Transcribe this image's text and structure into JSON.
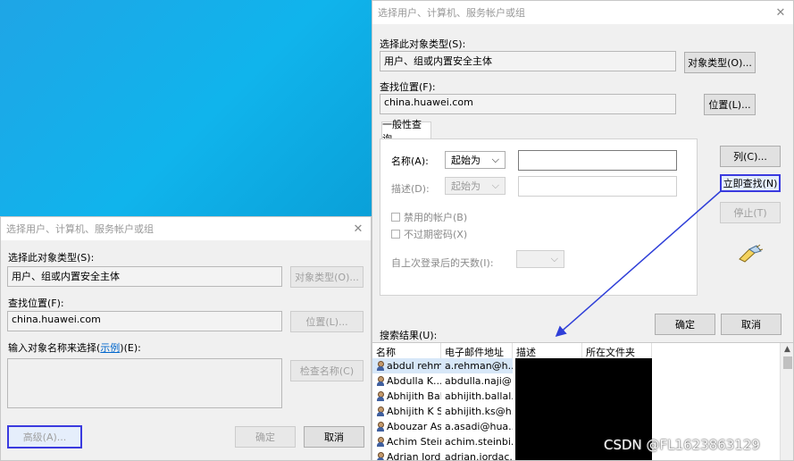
{
  "left_dialog": {
    "title": "选择用户、计算机、服务帐户或组",
    "object_type_label": "选择此对象类型(S):",
    "object_type_value": "用户、组或内置安全主体",
    "object_types_button": "对象类型(O)...",
    "location_label": "查找位置(F):",
    "location_value": "china.huawei.com",
    "location_button": "位置(L)...",
    "enter_names_label_prefix": "输入对象名称来选择(",
    "enter_names_link": "示例",
    "enter_names_label_suffix": ")(E):",
    "check_names_button": "检查名称(C)",
    "advanced_button": "高级(A)...",
    "ok_button": "确定",
    "cancel_button": "取消"
  },
  "right_dialog": {
    "title": "选择用户、计算机、服务帐户或组",
    "object_type_label": "选择此对象类型(S):",
    "object_type_value": "用户、组或内置安全主体",
    "object_types_button": "对象类型(O)...",
    "location_label": "查找位置(F):",
    "location_value": "china.huawei.com",
    "location_button": "位置(L)...",
    "tab_label": "一般性查询",
    "name_label": "名称(A):",
    "name_match": "起始为",
    "desc_label": "描述(D):",
    "desc_match": "起始为",
    "disabled_accounts": "禁用的帐户(B)",
    "non_expiring_pw": "不过期密码(X)",
    "days_since_logon": "自上次登录后的天数(I):",
    "columns_button": "列(C)...",
    "find_now_button": "立即查找(N)",
    "stop_button": "停止(T)",
    "ok_button": "确定",
    "cancel_button": "取消",
    "results_label": "搜索结果(U):",
    "columns": [
      "名称",
      "电子邮件地址",
      "描述",
      "所在文件夹"
    ],
    "rows": [
      {
        "name": "abdul rehm...",
        "email": "a.rehman@h..."
      },
      {
        "name": "Abdulla K...",
        "email": "abdulla.naji@..."
      },
      {
        "name": "Abhijith Bal...",
        "email": "abhijith.ballal..."
      },
      {
        "name": "Abhijith K S...",
        "email": "abhijith.ks@h..."
      },
      {
        "name": "Abouzar As...",
        "email": "a.asadi@hua..."
      },
      {
        "name": "Achim Stein...",
        "email": "achim.steinbi..."
      },
      {
        "name": "Adrian Jord...",
        "email": "adrian.jordac..."
      }
    ]
  },
  "watermark": "CSDN @FL1623863129",
  "colors": {
    "highlight_border": "#3a3adf",
    "arrow": "#2f3fd8",
    "desktop": "#10b4ec"
  }
}
